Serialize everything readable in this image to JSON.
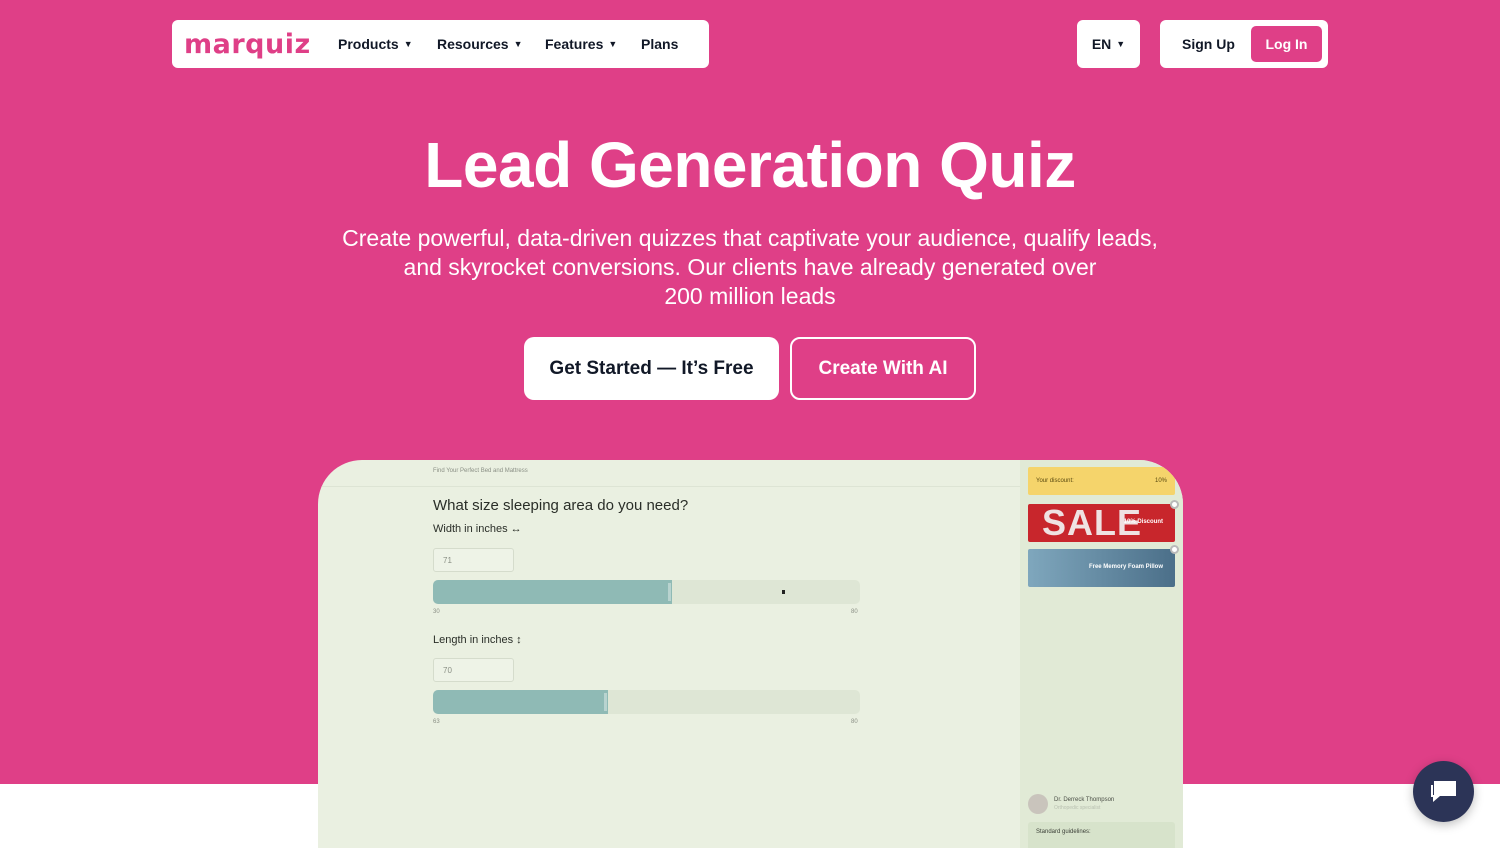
{
  "nav": {
    "logo": "marquiz",
    "products": "Products",
    "resources": "Resources",
    "features": "Features",
    "plans": "Plans",
    "language": "EN",
    "sign_up": "Sign Up",
    "log_in": "Log In"
  },
  "hero": {
    "title": "Lead Generation Quiz",
    "subtitle_line1": "Create powerful, data-driven quizzes that captivate your audience, qualify leads,",
    "subtitle_line2": "and skyrocket conversions. Our clients have already generated over",
    "subtitle_line3": "200 million leads",
    "cta_primary": "Get Started — It’s Free",
    "cta_ai": "Create With AI"
  },
  "preview": {
    "breadcrumb": "Find Your Perfect Bed and Mattress",
    "question": "What size sleeping area do you need?",
    "width": {
      "label": "Width in inches ↔",
      "value": "71",
      "min": "30",
      "max": "80",
      "fill": 0.56
    },
    "length": {
      "label": "Length in inches ↕",
      "value": "70",
      "min": "63",
      "max": "80",
      "fill": 0.41
    },
    "sidebar": {
      "discount_label": "Your discount:",
      "discount_value": "10%",
      "sale_image_text": "SALE",
      "sale_tag": "10% Discount",
      "pillow_tag": "Free Memory Foam Pillow",
      "doctor_name": "Dr. Derreck Thompson",
      "doctor_role": "Orthopedic specialist",
      "guidelines": "Standard guidelines:"
    }
  },
  "colors": {
    "brand": "#df3f87",
    "navy": "#2c3457",
    "preview_bg": "#eaf0e1",
    "slider_fill": "#8fbab5"
  },
  "icons": {
    "chevron": "chevron-down-icon",
    "chat": "chat-icon"
  }
}
